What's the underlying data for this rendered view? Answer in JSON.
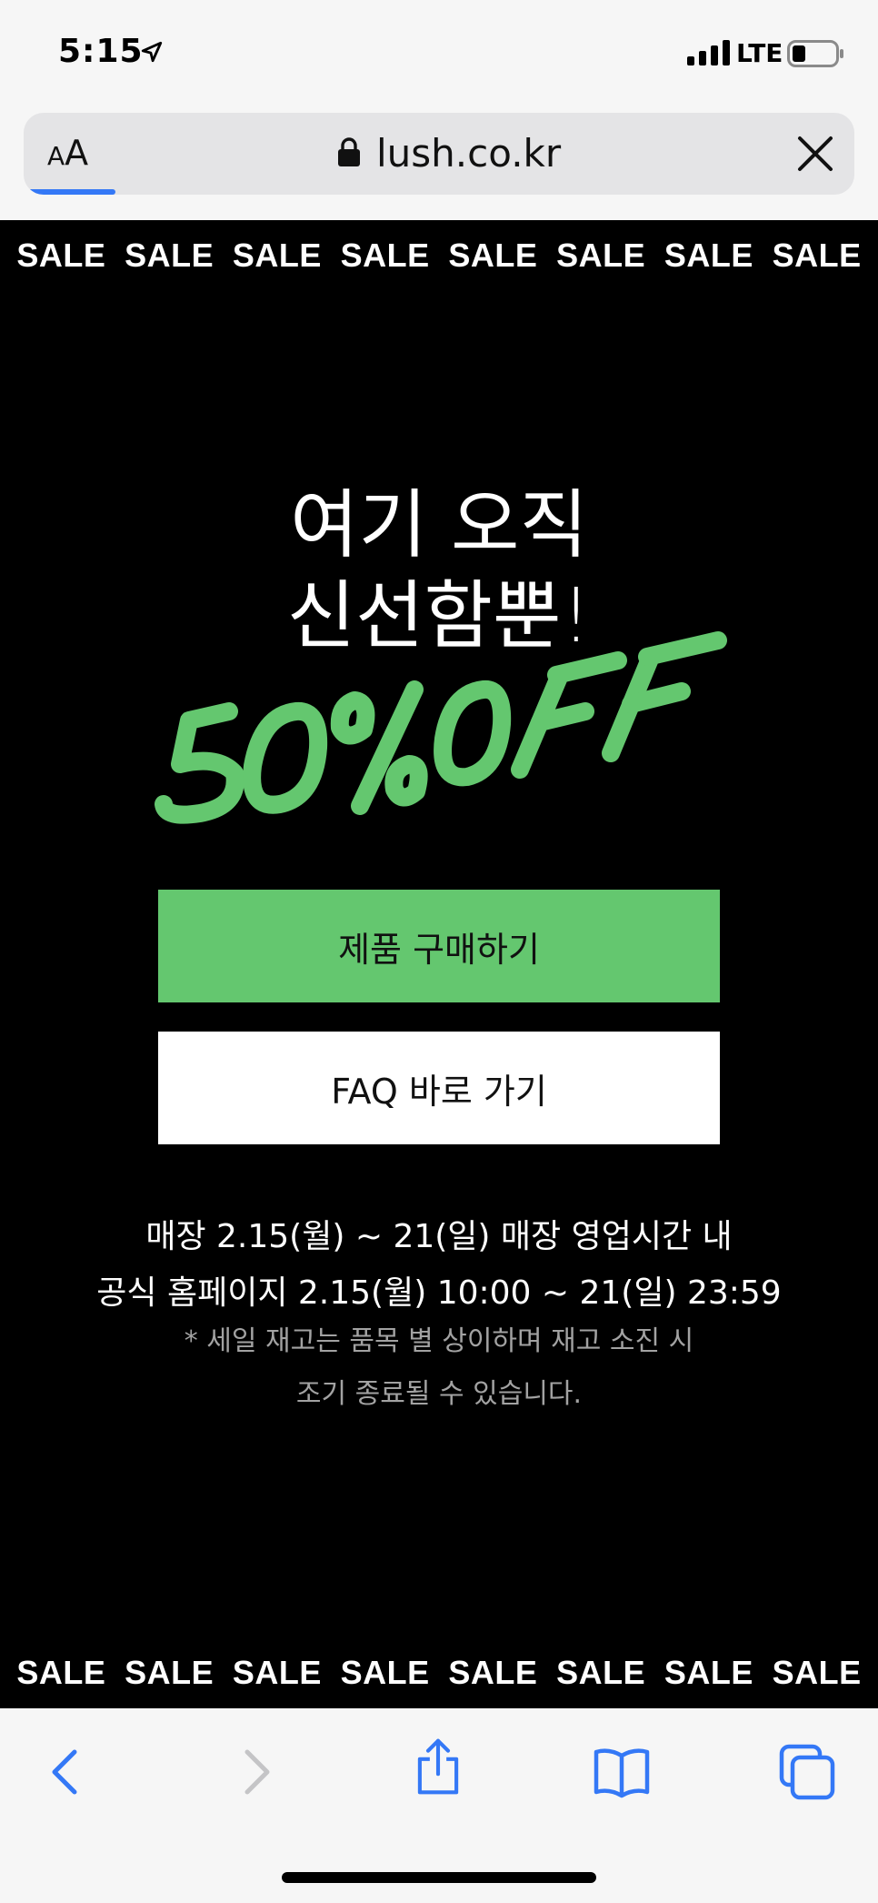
{
  "status_bar": {
    "time": "5:15",
    "carrier": "LTE"
  },
  "address_bar": {
    "text_size_small": "A",
    "text_size_large": "A",
    "url": "lush.co.kr",
    "load_progress": 0.11
  },
  "page": {
    "sale_banner": [
      "SALE",
      "SALE",
      "SALE",
      "SALE",
      "SALE",
      "SALE",
      "SALE",
      "SALE"
    ],
    "headline_line1": "여기 오직",
    "headline_line2": "신선함뿐!",
    "promo_graphic": "50% OFF",
    "buy_button_label": "제품 구매하기",
    "faq_button_label": "FAQ 바로 가기",
    "schedule_store": "매장 2.15(월) ~ 21(일) 매장 영업시간 내",
    "schedule_online": "공식 홈페이지 2.15(월) 10:00 ~ 21(일) 23:59",
    "note_line1": "* 세일 재고는 품목 별 상이하며 재고 소진 시",
    "note_line2": "조기 종료될 수 있습니다."
  },
  "colors": {
    "accent_green": "#64c76f",
    "page_background": "#000000",
    "progress_blue": "#3478f6"
  },
  "toolbar": {
    "icons": [
      "back-icon",
      "forward-icon",
      "share-icon",
      "bookmarks-icon",
      "tabs-icon"
    ]
  }
}
